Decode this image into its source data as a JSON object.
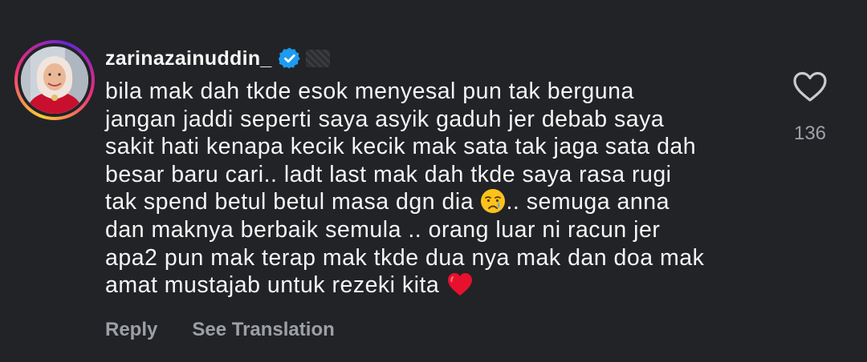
{
  "comment": {
    "username": "zarinazainuddin_",
    "verified": true,
    "lines": [
      "bila mak dah tkde esok menyesal pun tak berguna",
      "jangan jaddi seperti saya asyik gaduh jer debab saya",
      "sakit hati kenapa kecik kecik mak sata tak jaga sata dah",
      "besar baru cari.. ladt last mak dah tkde saya rasa rugi",
      "tak spend betul betul masa dgn dia",
      ".. semuga anna",
      "dan maknya berbaik semula .. orang luar ni racun jer",
      "apa2 pun mak terap mak tkde dua nya mak dan doa mak",
      "amat mustajab untuk rezeki kita"
    ],
    "emojis": {
      "crying": "crying-face-icon",
      "heart": "red-heart-icon"
    },
    "actions": {
      "reply": "Reply",
      "see_translation": "See Translation"
    },
    "likes": {
      "count": "136"
    },
    "colors": {
      "background": "#222326",
      "text": "#f5f5f5",
      "muted": "#9ca0a6",
      "verified": "#1d9bf0",
      "heart": "#e8112d"
    }
  }
}
